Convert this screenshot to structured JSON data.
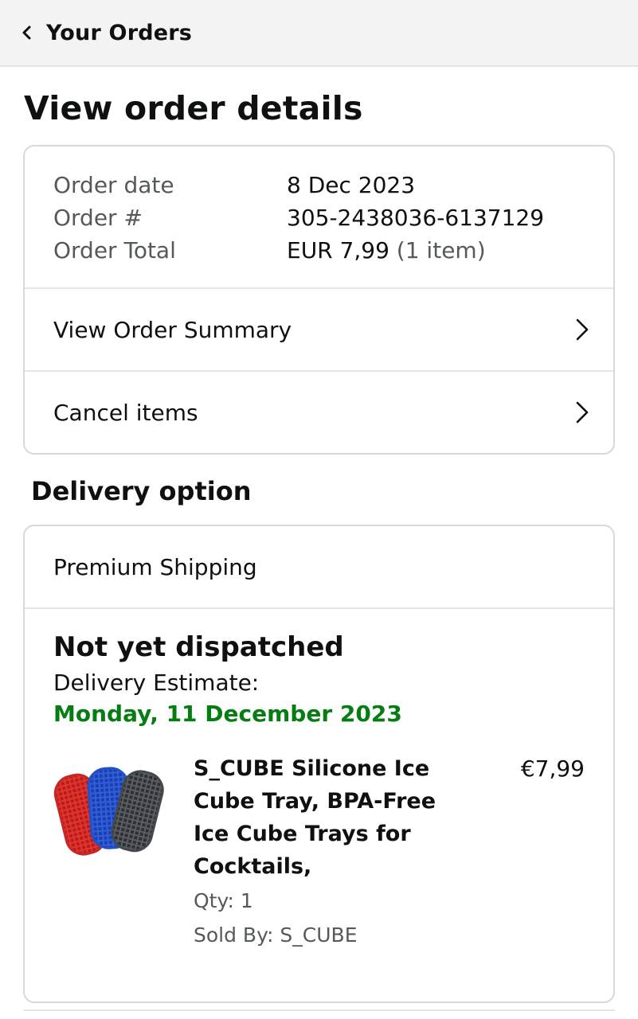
{
  "header": {
    "back_label": "Your Orders"
  },
  "page": {
    "title": "View order details"
  },
  "order": {
    "rows": [
      {
        "label": "Order date",
        "value": "8 Dec 2023"
      },
      {
        "label": "Order #",
        "value": "305-2438036-6137129"
      },
      {
        "label": "Order Total",
        "value": "EUR 7,99",
        "extra": "(1 item)"
      }
    ],
    "links": {
      "summary": "View Order Summary",
      "cancel": "Cancel items"
    }
  },
  "delivery": {
    "section_title": "Delivery option",
    "shipping_method": "Premium Shipping",
    "status": "Not yet dispatched",
    "estimate_label": "Delivery Estimate:",
    "estimate_date": "Monday, 11 December 2023",
    "item": {
      "title": "S_CUBE Silicone Ice Cube Tray, BPA-Free Ice Cube Trays for Cocktails,",
      "price": "€7,99",
      "qty": "Qty: 1",
      "sold_by": "Sold By: S_CUBE",
      "thumbnail_icon": "ice-cube-trays-image"
    }
  },
  "colors": {
    "estimate_green": "#067d12",
    "muted_text": "#565959",
    "header_bg": "#f3f3f3"
  }
}
